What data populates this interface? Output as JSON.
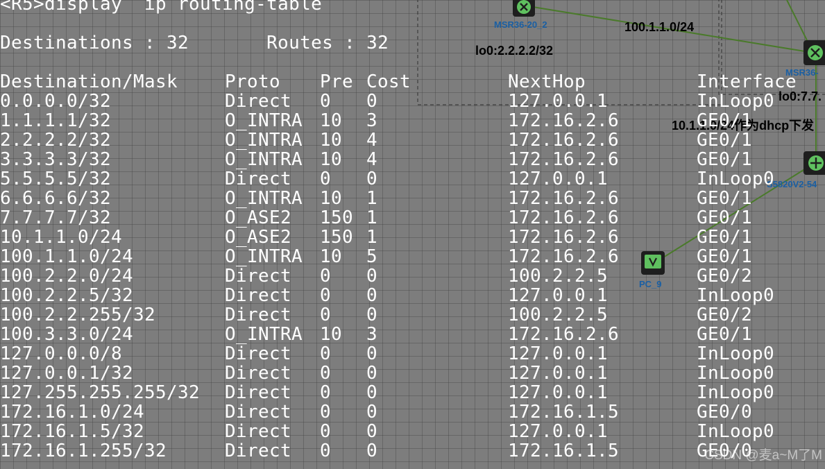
{
  "terminal": {
    "command": "<R5>display  ip routing-table",
    "summary": "Destinations : 32       Routes : 32",
    "columns": {
      "destination": "Destination/Mask",
      "proto": "Proto",
      "pre": "Pre",
      "cost": "Cost",
      "nexthop": "NextHop",
      "interface": "Interface"
    },
    "rows": [
      {
        "dest": "0.0.0.0/32",
        "proto": "Direct",
        "pre": "0",
        "cost": "0",
        "nexthop": "127.0.0.1",
        "iface": "InLoop0"
      },
      {
        "dest": "1.1.1.1/32",
        "proto": "O_INTRA",
        "pre": "10",
        "cost": "3",
        "nexthop": "172.16.2.6",
        "iface": "GE0/1"
      },
      {
        "dest": "2.2.2.2/32",
        "proto": "O_INTRA",
        "pre": "10",
        "cost": "4",
        "nexthop": "172.16.2.6",
        "iface": "GE0/1"
      },
      {
        "dest": "3.3.3.3/32",
        "proto": "O_INTRA",
        "pre": "10",
        "cost": "4",
        "nexthop": "172.16.2.6",
        "iface": "GE0/1"
      },
      {
        "dest": "5.5.5.5/32",
        "proto": "Direct",
        "pre": "0",
        "cost": "0",
        "nexthop": "127.0.0.1",
        "iface": "InLoop0"
      },
      {
        "dest": "6.6.6.6/32",
        "proto": "O_INTRA",
        "pre": "10",
        "cost": "1",
        "nexthop": "172.16.2.6",
        "iface": "GE0/1"
      },
      {
        "dest": "7.7.7.7/32",
        "proto": "O_ASE2",
        "pre": "150",
        "cost": "1",
        "nexthop": "172.16.2.6",
        "iface": "GE0/1"
      },
      {
        "dest": "10.1.1.0/24",
        "proto": "O_ASE2",
        "pre": "150",
        "cost": "1",
        "nexthop": "172.16.2.6",
        "iface": "GE0/1"
      },
      {
        "dest": "100.1.1.0/24",
        "proto": "O_INTRA",
        "pre": "10",
        "cost": "5",
        "nexthop": "172.16.2.6",
        "iface": "GE0/1"
      },
      {
        "dest": "100.2.2.0/24",
        "proto": "Direct",
        "pre": "0",
        "cost": "0",
        "nexthop": "100.2.2.5",
        "iface": "GE0/2"
      },
      {
        "dest": "100.2.2.5/32",
        "proto": "Direct",
        "pre": "0",
        "cost": "0",
        "nexthop": "127.0.0.1",
        "iface": "InLoop0"
      },
      {
        "dest": "100.2.2.255/32",
        "proto": "Direct",
        "pre": "0",
        "cost": "0",
        "nexthop": "100.2.2.5",
        "iface": "GE0/2"
      },
      {
        "dest": "100.3.3.0/24",
        "proto": "O_INTRA",
        "pre": "10",
        "cost": "3",
        "nexthop": "172.16.2.6",
        "iface": "GE0/1"
      },
      {
        "dest": "127.0.0.0/8",
        "proto": "Direct",
        "pre": "0",
        "cost": "0",
        "nexthop": "127.0.0.1",
        "iface": "InLoop0"
      },
      {
        "dest": "127.0.0.1/32",
        "proto": "Direct",
        "pre": "0",
        "cost": "0",
        "nexthop": "127.0.0.1",
        "iface": "InLoop0"
      },
      {
        "dest": "127.255.255.255/32",
        "proto": "Direct",
        "pre": "0",
        "cost": "0",
        "nexthop": "127.0.0.1",
        "iface": "InLoop0"
      },
      {
        "dest": "172.16.1.0/24",
        "proto": "Direct",
        "pre": "0",
        "cost": "0",
        "nexthop": "172.16.1.5",
        "iface": "GE0/0"
      },
      {
        "dest": "172.16.1.5/32",
        "proto": "Direct",
        "pre": "0",
        "cost": "0",
        "nexthop": "127.0.0.1",
        "iface": "InLoop0"
      },
      {
        "dest": "172.16.1.255/32",
        "proto": "Direct",
        "pre": "0",
        "cost": "0",
        "nexthop": "172.16.1.5",
        "iface": "GE0/0"
      }
    ]
  },
  "topology": {
    "devices": {
      "router_a": "MSR36-20_2",
      "router_b": "MSR36-",
      "switch": "S5820V2-54",
      "pc": "PC_9"
    },
    "labels": {
      "link_net": "100.1.1.0/24",
      "loopback_a": "lo0:2.2.2.2/32",
      "loopback_b": "lo0:7.7.",
      "dhcp_note": "10.1.1.0/24作为dhcp下发"
    }
  },
  "watermark": "CSDN @麦a~M了M",
  "colors": {
    "terminal_text": "#ffffff",
    "canvas_bg": "#7d7d7d",
    "link_line": "#4a7a2a",
    "device_label": "#1a5fa3",
    "annotation_text": "#000000"
  }
}
